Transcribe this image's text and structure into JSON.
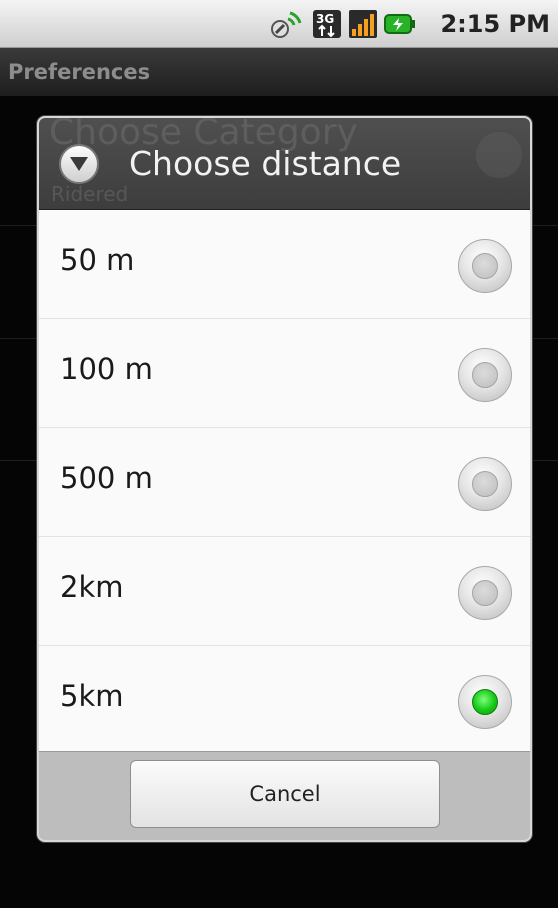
{
  "status_bar": {
    "time": "2:15 PM",
    "icons": [
      "gps-icon",
      "3g-data-icon",
      "signal-strength-icon",
      "battery-charging-icon"
    ]
  },
  "app_bar": {
    "title": "Preferences"
  },
  "background_list": {
    "item_title": "Choose Category",
    "item_subtitle": "Ridered"
  },
  "dialog": {
    "title": "Choose distance",
    "icon": "dropdown-arrow-icon",
    "options": [
      {
        "label": "50 m",
        "checked": false
      },
      {
        "label": "100 m",
        "checked": false
      },
      {
        "label": "500 m",
        "checked": false
      },
      {
        "label": "2km",
        "checked": false
      },
      {
        "label": "5km",
        "checked": true
      }
    ],
    "cancel_label": "Cancel"
  },
  "colors": {
    "selected_radio": "#16c916",
    "dialog_header": "#3d3d3d",
    "button_bar": "#bdbdbd"
  }
}
